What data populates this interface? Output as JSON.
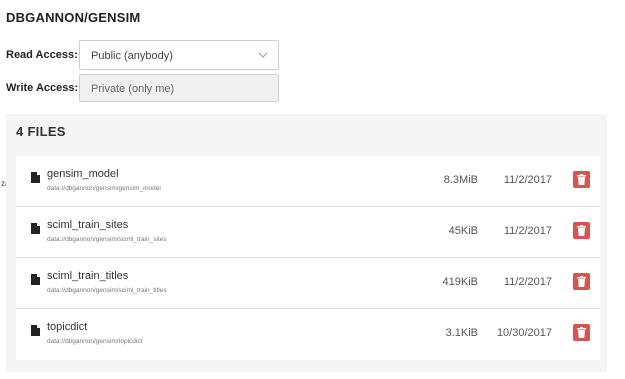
{
  "project": {
    "title": "DBGANNON/GENSIM"
  },
  "access": {
    "read_label": "Read Access:",
    "read_value": "Public (anybody)",
    "write_label": "Write Access:",
    "write_value": "Private (only me)"
  },
  "files": {
    "header": "4 FILES",
    "items": [
      {
        "name": "gensim_model",
        "path": "data://dbgannon/gensim/gensim_model",
        "size": "8.3MiB",
        "date": "11/2/2017"
      },
      {
        "name": "sciml_train_sites",
        "path": "data://dbgannon/gensim/sciml_train_sites",
        "size": "45KiB",
        "date": "11/2/2017"
      },
      {
        "name": "sciml_train_titles",
        "path": "data://dbgannon/gensim/sciml_train_titles",
        "size": "419KiB",
        "date": "11/2/2017"
      },
      {
        "name": "topicdict",
        "path": "data://dbgannon/gensim/topicdict",
        "size": "3.1KiB",
        "date": "10/30/2017"
      }
    ]
  },
  "stray_text": "za",
  "colors": {
    "delete": "#d9534f",
    "panel_bg": "#f5f5f5"
  },
  "icons": {
    "file": "file-icon",
    "delete": "trash-icon",
    "dropdown": "chevron-down-icon"
  }
}
